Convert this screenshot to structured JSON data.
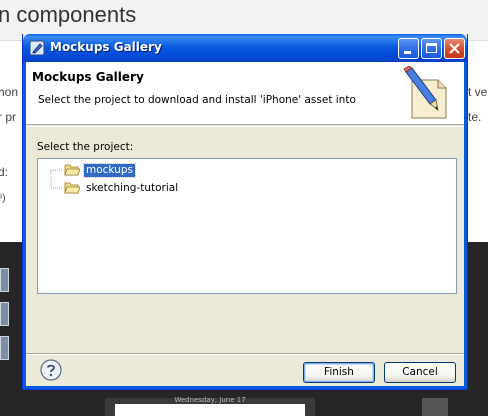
{
  "background": {
    "heading": "n components",
    "left_fragments": [
      "hon",
      "r pr",
      "d:",
      "⁹)"
    ],
    "right_fragments": [
      "t ve",
      "te."
    ],
    "phone_date": "Wednesday, June 17"
  },
  "dialog": {
    "window_title": "Mockups Gallery",
    "header_title": "Mockups Gallery",
    "header_description": "Select the project to download and install 'iPhone' asset into",
    "select_label": "Select the project:",
    "projects": [
      {
        "label": "mockups",
        "selected": true
      },
      {
        "label": "sketching-tutorial",
        "selected": false
      }
    ],
    "buttons": {
      "finish": "Finish",
      "cancel": "Cancel"
    }
  },
  "colors": {
    "titlebar": "#0a5ae0",
    "selection": "#316ac5",
    "dialog_bg": "#ece9d8"
  },
  "icons": {
    "title_icon": "pencil-app-icon",
    "wizard_banner": "pencil-paper-icon",
    "folder": "open-folder-icon",
    "help": "help-icon"
  }
}
